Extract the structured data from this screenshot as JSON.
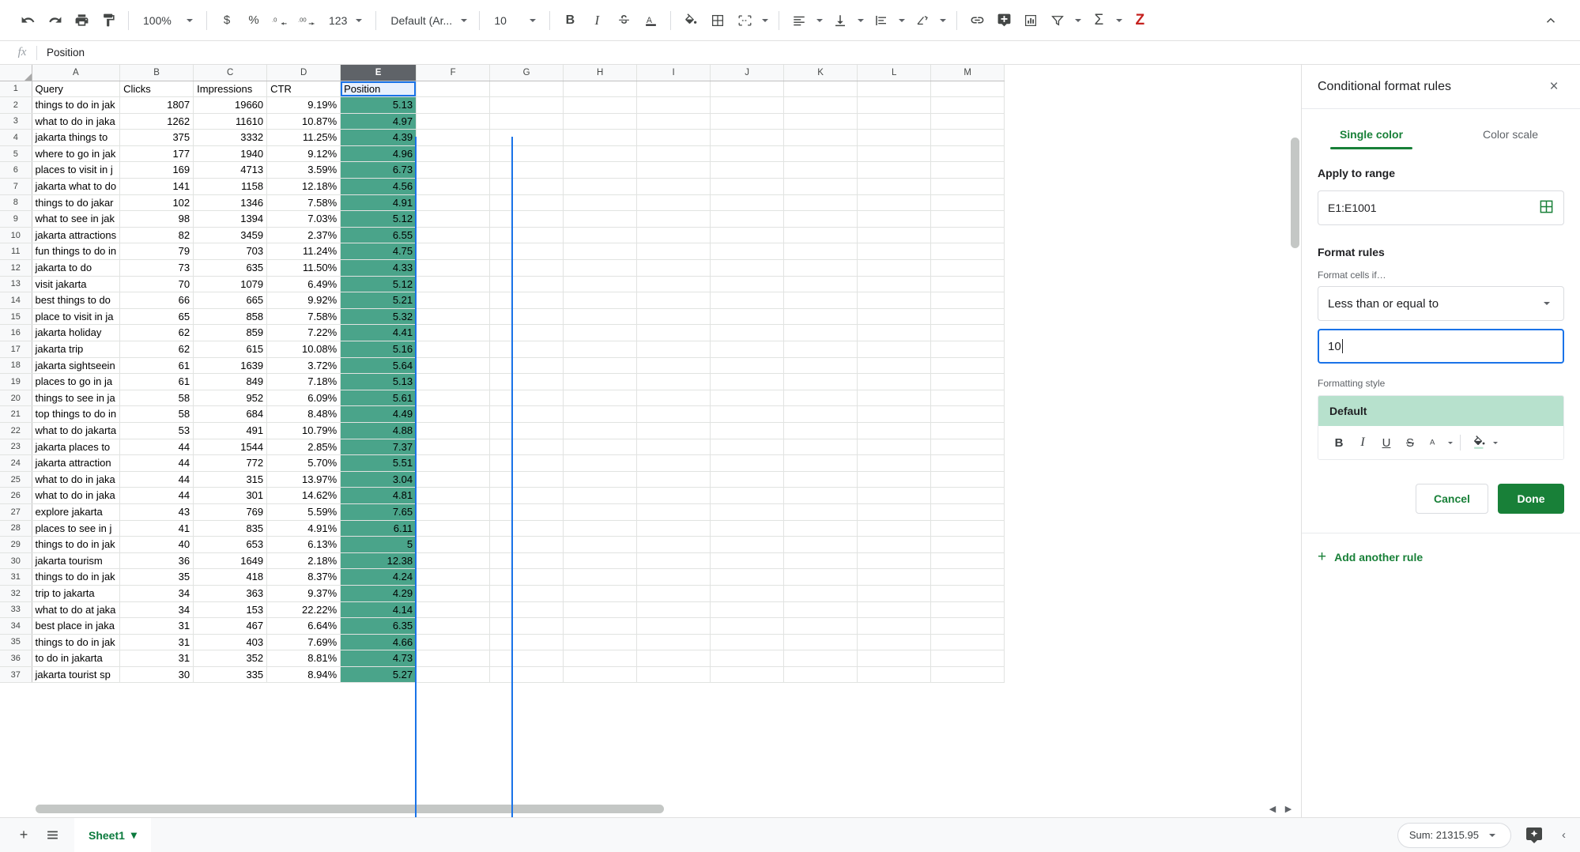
{
  "toolbar": {
    "undo": "undo-arrow",
    "redo": "redo-arrow",
    "print": "printer",
    "paint_format": "paint-format",
    "zoom_value": "100%",
    "currency": "$",
    "percent": "%",
    "decrease_decimal": ".0",
    "increase_decimal": ".00",
    "number_format": "123",
    "font_value": "Default (Ar...",
    "font_size_value": "10",
    "bold": "B",
    "italic": "I",
    "strikethrough": "S",
    "text_color": "A",
    "fill_color": "fill-bucket",
    "borders": "borders",
    "merge_cells": "merge",
    "horizontal_align": "align-left",
    "vertical_align": "align-bottom",
    "text_wrap": "wrap",
    "text_rotation": "rotate",
    "insert_link": "link",
    "insert_comment": "comment",
    "insert_chart": "chart",
    "create_filter": "filter",
    "functions": "Σ",
    "zoho_z": "Z",
    "collapse": "chevron-up"
  },
  "formula_bar": {
    "fx": "fx",
    "value": "Position"
  },
  "grid": {
    "columns": [
      "A",
      "B",
      "C",
      "D",
      "E",
      "F",
      "G",
      "H",
      "I",
      "J",
      "K",
      "L",
      "M"
    ],
    "active_column": "E",
    "header_row": {
      "n": "1",
      "a": "Query",
      "b": "Clicks",
      "c": "Impressions",
      "d": "CTR",
      "e": "Position"
    },
    "rows": [
      {
        "n": "2",
        "query": "things to do in jak",
        "clicks": "1807",
        "impressions": "19660",
        "ctr": "9.19%",
        "position": "5.13"
      },
      {
        "n": "3",
        "query": "what to do in jaka",
        "clicks": "1262",
        "impressions": "11610",
        "ctr": "10.87%",
        "position": "4.97"
      },
      {
        "n": "4",
        "query": "jakarta things to",
        "clicks": "375",
        "impressions": "3332",
        "ctr": "11.25%",
        "position": "4.39"
      },
      {
        "n": "5",
        "query": "where to go in jak",
        "clicks": "177",
        "impressions": "1940",
        "ctr": "9.12%",
        "position": "4.96"
      },
      {
        "n": "6",
        "query": "places to visit in j",
        "clicks": "169",
        "impressions": "4713",
        "ctr": "3.59%",
        "position": "6.73"
      },
      {
        "n": "7",
        "query": "jakarta what to do",
        "clicks": "141",
        "impressions": "1158",
        "ctr": "12.18%",
        "position": "4.56"
      },
      {
        "n": "8",
        "query": "things to do jakar",
        "clicks": "102",
        "impressions": "1346",
        "ctr": "7.58%",
        "position": "4.91"
      },
      {
        "n": "9",
        "query": "what to see in jak",
        "clicks": "98",
        "impressions": "1394",
        "ctr": "7.03%",
        "position": "5.12"
      },
      {
        "n": "10",
        "query": "jakarta attractions",
        "clicks": "82",
        "impressions": "3459",
        "ctr": "2.37%",
        "position": "6.55"
      },
      {
        "n": "11",
        "query": "fun things to do in",
        "clicks": "79",
        "impressions": "703",
        "ctr": "11.24%",
        "position": "4.75"
      },
      {
        "n": "12",
        "query": "jakarta to do",
        "clicks": "73",
        "impressions": "635",
        "ctr": "11.50%",
        "position": "4.33"
      },
      {
        "n": "13",
        "query": "visit jakarta",
        "clicks": "70",
        "impressions": "1079",
        "ctr": "6.49%",
        "position": "5.12"
      },
      {
        "n": "14",
        "query": "best things to do",
        "clicks": "66",
        "impressions": "665",
        "ctr": "9.92%",
        "position": "5.21"
      },
      {
        "n": "15",
        "query": "place to visit in ja",
        "clicks": "65",
        "impressions": "858",
        "ctr": "7.58%",
        "position": "5.32"
      },
      {
        "n": "16",
        "query": "jakarta holiday",
        "clicks": "62",
        "impressions": "859",
        "ctr": "7.22%",
        "position": "4.41"
      },
      {
        "n": "17",
        "query": "jakarta trip",
        "clicks": "62",
        "impressions": "615",
        "ctr": "10.08%",
        "position": "5.16"
      },
      {
        "n": "18",
        "query": "jakarta sightseein",
        "clicks": "61",
        "impressions": "1639",
        "ctr": "3.72%",
        "position": "5.64"
      },
      {
        "n": "19",
        "query": "places to go in ja",
        "clicks": "61",
        "impressions": "849",
        "ctr": "7.18%",
        "position": "5.13"
      },
      {
        "n": "20",
        "query": "things to see in ja",
        "clicks": "58",
        "impressions": "952",
        "ctr": "6.09%",
        "position": "5.61"
      },
      {
        "n": "21",
        "query": "top things to do in",
        "clicks": "58",
        "impressions": "684",
        "ctr": "8.48%",
        "position": "4.49"
      },
      {
        "n": "22",
        "query": "what to do jakarta",
        "clicks": "53",
        "impressions": "491",
        "ctr": "10.79%",
        "position": "4.88"
      },
      {
        "n": "23",
        "query": "jakarta places to",
        "clicks": "44",
        "impressions": "1544",
        "ctr": "2.85%",
        "position": "7.37"
      },
      {
        "n": "24",
        "query": "jakarta attraction",
        "clicks": "44",
        "impressions": "772",
        "ctr": "5.70%",
        "position": "5.51"
      },
      {
        "n": "25",
        "query": "what to do in jaka",
        "clicks": "44",
        "impressions": "315",
        "ctr": "13.97%",
        "position": "3.04"
      },
      {
        "n": "26",
        "query": "what to do in jaka",
        "clicks": "44",
        "impressions": "301",
        "ctr": "14.62%",
        "position": "4.81"
      },
      {
        "n": "27",
        "query": "explore jakarta",
        "clicks": "43",
        "impressions": "769",
        "ctr": "5.59%",
        "position": "7.65"
      },
      {
        "n": "28",
        "query": "places to see in j",
        "clicks": "41",
        "impressions": "835",
        "ctr": "4.91%",
        "position": "6.11"
      },
      {
        "n": "29",
        "query": "things to do in jak",
        "clicks": "40",
        "impressions": "653",
        "ctr": "6.13%",
        "position": "5"
      },
      {
        "n": "30",
        "query": "jakarta tourism",
        "clicks": "36",
        "impressions": "1649",
        "ctr": "2.18%",
        "position": "12.38"
      },
      {
        "n": "31",
        "query": "things to do in jak",
        "clicks": "35",
        "impressions": "418",
        "ctr": "8.37%",
        "position": "4.24"
      },
      {
        "n": "32",
        "query": "trip to jakarta",
        "clicks": "34",
        "impressions": "363",
        "ctr": "9.37%",
        "position": "4.29"
      },
      {
        "n": "33",
        "query": "what to do at jaka",
        "clicks": "34",
        "impressions": "153",
        "ctr": "22.22%",
        "position": "4.14"
      },
      {
        "n": "34",
        "query": "best place in jaka",
        "clicks": "31",
        "impressions": "467",
        "ctr": "6.64%",
        "position": "6.35"
      },
      {
        "n": "35",
        "query": "things to do in jak",
        "clicks": "31",
        "impressions": "403",
        "ctr": "7.69%",
        "position": "4.66"
      },
      {
        "n": "36",
        "query": "to do in jakarta",
        "clicks": "31",
        "impressions": "352",
        "ctr": "8.81%",
        "position": "4.73"
      },
      {
        "n": "37",
        "query": "jakarta tourist sp",
        "clicks": "30",
        "impressions": "335",
        "ctr": "8.94%",
        "position": "5.27"
      }
    ]
  },
  "panel": {
    "title": "Conditional format rules",
    "close_icon": "×",
    "tabs": [
      {
        "label": "Single color",
        "active": true
      },
      {
        "label": "Color scale",
        "active": false
      }
    ],
    "apply_to_range_label": "Apply to range",
    "range_value": "E1:E1001",
    "range_picker_icon": "grid-picker",
    "format_rules_label": "Format rules",
    "format_cells_if_label": "Format cells if…",
    "condition_value": "Less than or equal to",
    "threshold_value": "10",
    "formatting_style_label": "Formatting style",
    "style_preview_text": "Default",
    "style_preview_bg": "#b7e1cd",
    "style_buttons": {
      "bold": "B",
      "italic": "I",
      "underline": "U",
      "strikethrough": "S",
      "text_color": "A",
      "fill_color": "fill-bucket"
    },
    "cancel_label": "Cancel",
    "done_label": "Done",
    "add_rule_label": "Add another rule",
    "add_rule_plus": "+",
    "accent_green": "#188038",
    "accent_blue": "#1a73e8"
  },
  "bottom": {
    "add_sheet_icon": "+",
    "all_sheets_icon": "list",
    "sheet_name": "Sheet1",
    "sheet_caret": "▾",
    "sum_label": "Sum: 21315.95",
    "explore_icon": "explore-sparkle",
    "collapse_icon": "‹"
  }
}
